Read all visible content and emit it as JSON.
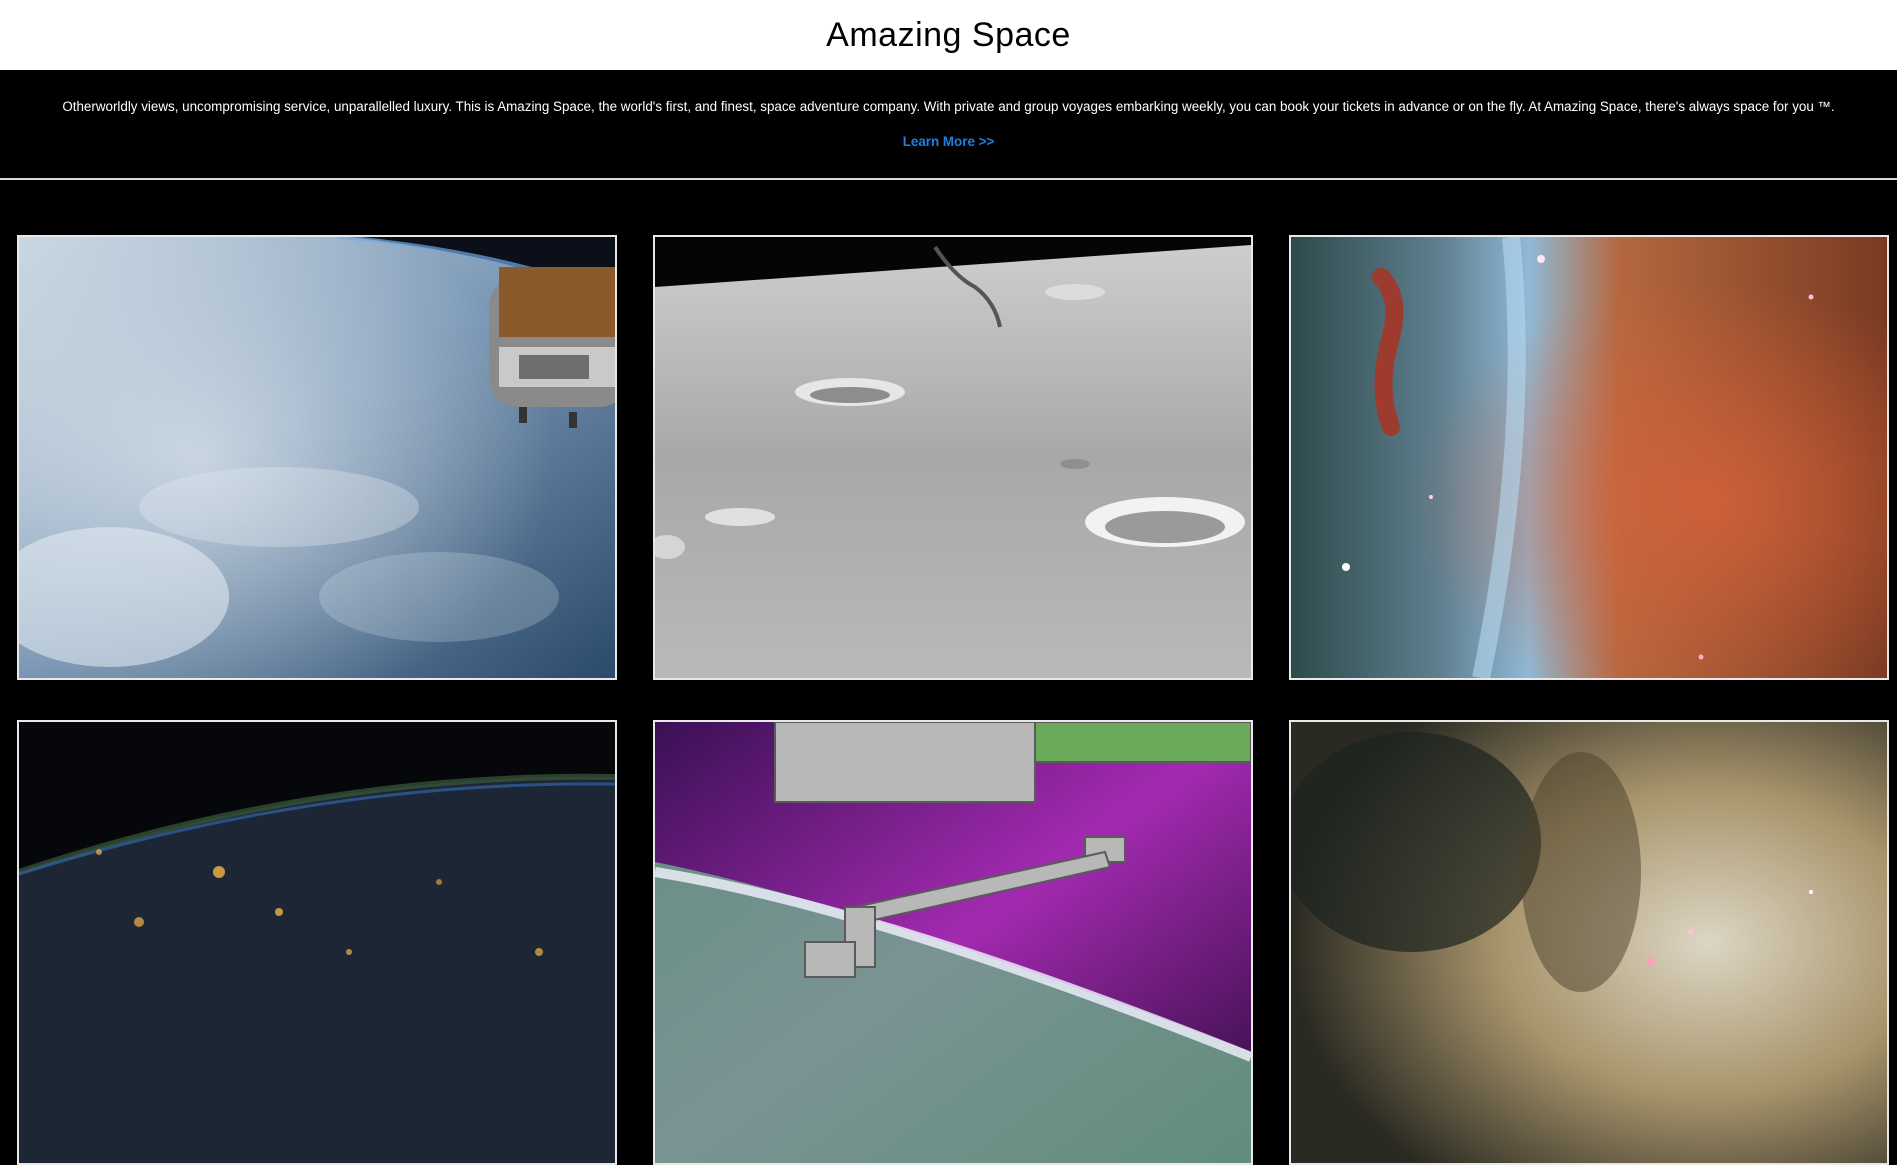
{
  "header": {
    "title": "Amazing Space"
  },
  "intro": {
    "text": "Otherworldly views, uncompromising service, unparallelled luxury. This is Amazing Space, the world's first, and finest, space adventure company. With private and group voyages embarking weekly, you can book your tickets in advance or on the fly. At Amazing Space, there's always space for you ™.",
    "link_label": "Learn More >>",
    "link_color": "#1f7fe0"
  },
  "gallery": {
    "images": [
      {
        "subject": "earth-with-space-station"
      },
      {
        "subject": "lunar-surface-craters"
      },
      {
        "subject": "colorful-nebula"
      },
      {
        "subject": "earth-night-city-lights"
      },
      {
        "subject": "robotic-arm-aurora"
      },
      {
        "subject": "dusty-nebula"
      }
    ]
  }
}
